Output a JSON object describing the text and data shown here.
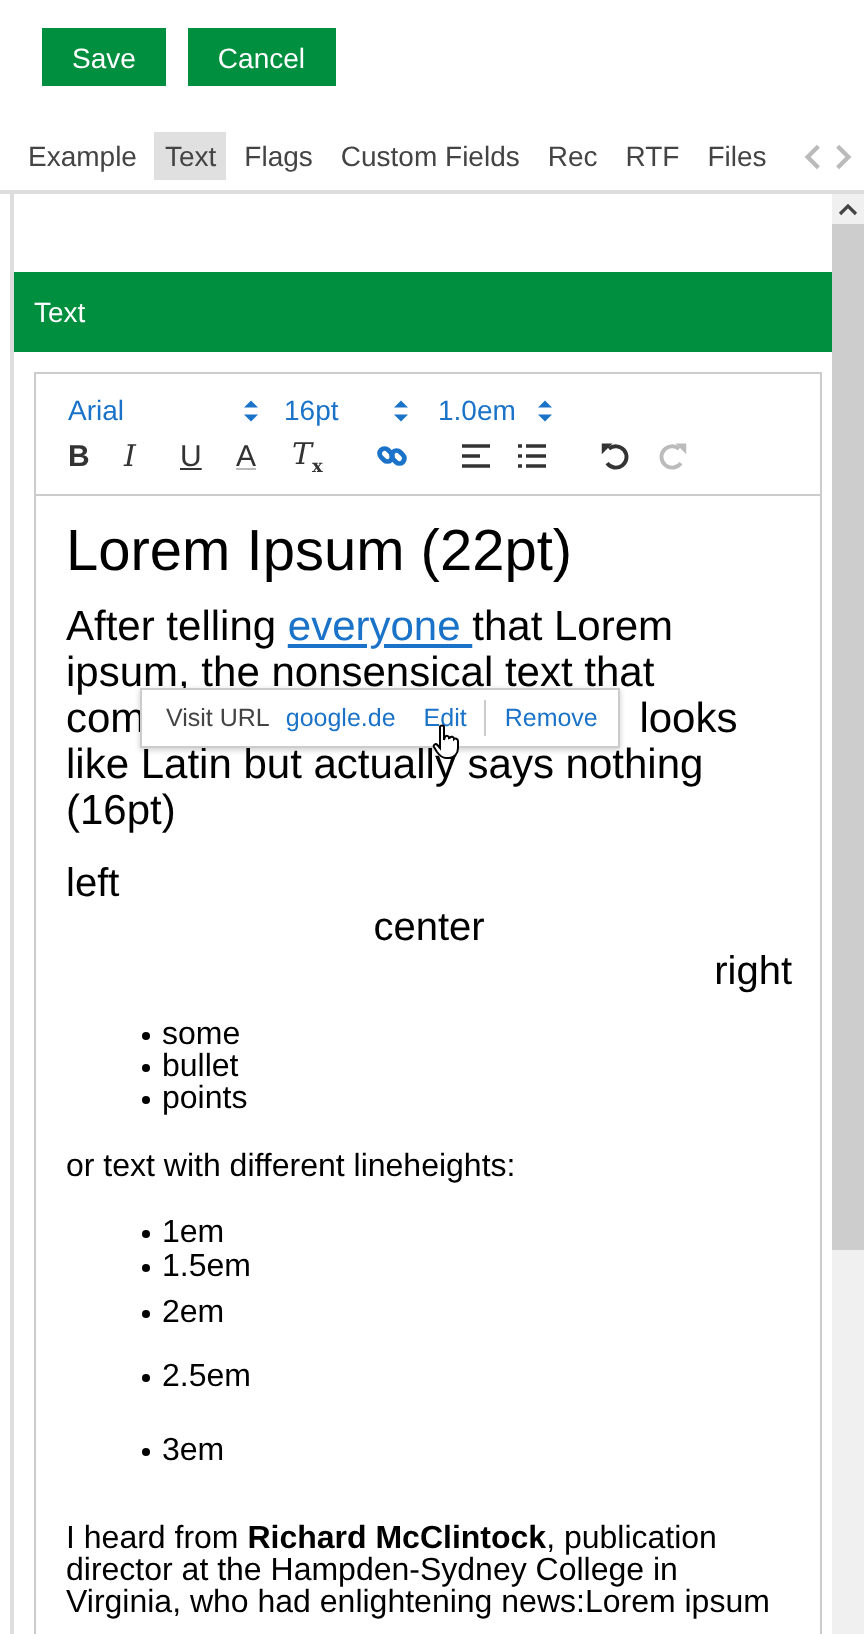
{
  "actions": [
    {
      "label": "Save"
    },
    {
      "label": "Cancel"
    }
  ],
  "tabs": [
    {
      "label": "Example",
      "selected": false
    },
    {
      "label": "Text",
      "selected": true
    },
    {
      "label": "Flags",
      "selected": false
    },
    {
      "label": "Custom Fields",
      "selected": false
    },
    {
      "label": "Rec",
      "selected": false
    },
    {
      "label": "RTF",
      "selected": false
    },
    {
      "label": "Files",
      "selected": false
    }
  ],
  "section": {
    "title": "Text"
  },
  "editor": {
    "selects": [
      {
        "value": "Arial"
      },
      {
        "value": "16pt"
      },
      {
        "value": "1.0em"
      }
    ],
    "tools": [
      {
        "kind": "bold",
        "label": "B",
        "disabled": false
      },
      {
        "kind": "italic",
        "label": "I",
        "disabled": false
      },
      {
        "kind": "underline",
        "label": "U",
        "disabled": false
      },
      {
        "kind": "color",
        "label": "A",
        "disabled": false
      },
      {
        "kind": "clear",
        "label": "T",
        "sub": "x",
        "disabled": false
      },
      {
        "kind": "link",
        "disabled": false
      },
      {
        "kind": "align",
        "disabled": false
      },
      {
        "kind": "list",
        "disabled": false
      },
      {
        "kind": "undo",
        "disabled": false
      },
      {
        "kind": "redo",
        "disabled": true
      }
    ],
    "heading": "Lorem Ipsum (22pt)",
    "paragraph": {
      "before": "After telling ",
      "link": "everyone ",
      "lines": [
        "that Lorem",
        "ipsum, the nonsensical text that"
      ],
      "line3_start": "com",
      "line3_end": "looks",
      "rest": [
        "like Latin but actually says nothing",
        "(16pt)"
      ]
    },
    "link_popup": {
      "label": "Visit URL",
      "url": "google.de",
      "edit": "Edit",
      "remove": "Remove"
    },
    "aligned": [
      "left",
      "center",
      "right"
    ],
    "bullets": [
      "some",
      "bullet",
      "points"
    ],
    "lineheight_intro": "or text with different lineheights:",
    "lineheight_items": [
      "1em",
      "1.5em",
      "2em",
      "2.5em",
      "3em"
    ],
    "closing": "I heard from **Richard McClintock**, publication director at the Hampden-Sydney College in Virginia, who had enlightening news:Lorem ipsum"
  }
}
